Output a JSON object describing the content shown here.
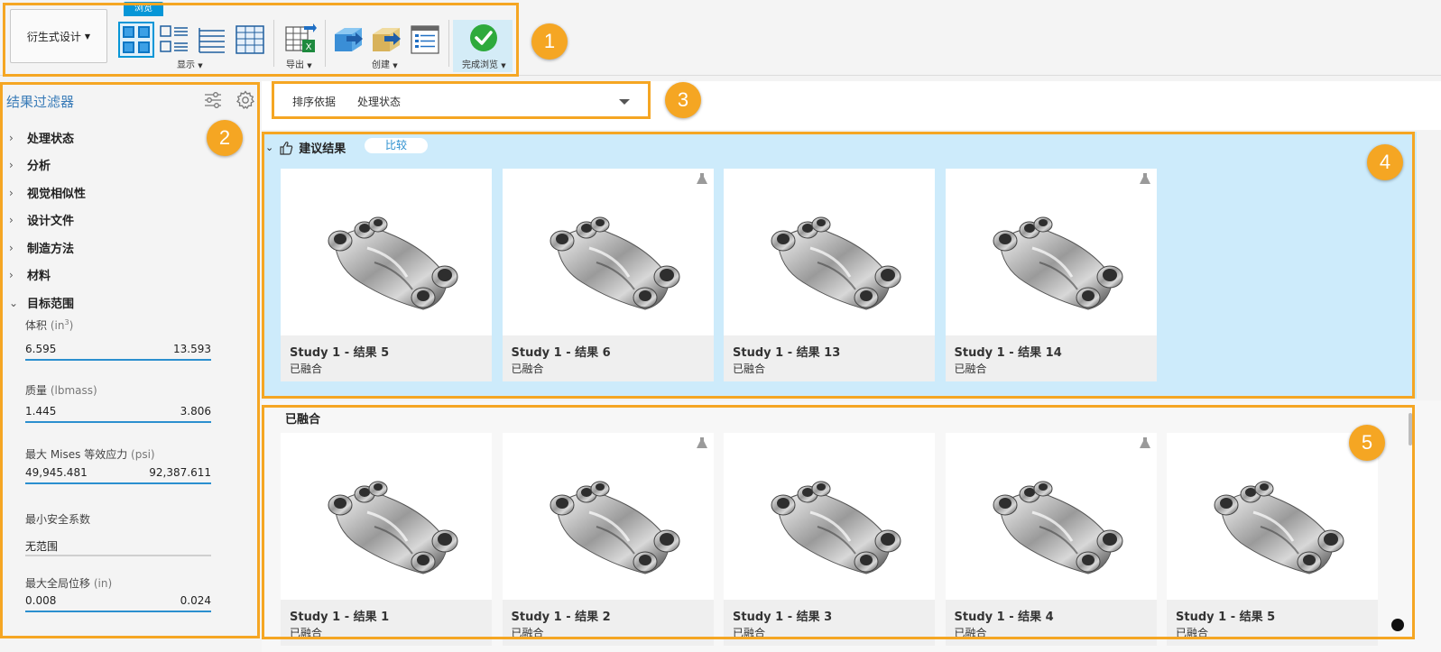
{
  "ribbon": {
    "workspace_label": "衍生式设计",
    "active_tab": "浏览",
    "panels": {
      "display": "显示",
      "export": "导出",
      "create": "创建",
      "finish": "完成浏览"
    }
  },
  "sidebar": {
    "title": "结果过滤器",
    "filters": [
      {
        "label": "处理状态",
        "expanded": false
      },
      {
        "label": "分析",
        "expanded": false
      },
      {
        "label": "视觉相似性",
        "expanded": false
      },
      {
        "label": "设计文件",
        "expanded": false
      },
      {
        "label": "制造方法",
        "expanded": false
      },
      {
        "label": "材料",
        "expanded": false
      },
      {
        "label": "目标范围",
        "expanded": true
      }
    ],
    "ranges": [
      {
        "label": "体积",
        "unit_pre": "(in",
        "unit_sup": "3",
        "unit_post": ")",
        "min": "6.595",
        "max": "13.593"
      },
      {
        "label": "质量",
        "unit": "(lbmass)",
        "min": "1.445",
        "max": "3.806"
      },
      {
        "label": "最大 Mises 等效应力",
        "unit": "(psi)",
        "min": "49,945.481",
        "max": "92,387.611"
      },
      {
        "label": "最小安全系数",
        "unit": "",
        "value": "无范围"
      },
      {
        "label": "最大全局位移",
        "unit": "(in)",
        "min": "0.008",
        "max": "0.024"
      }
    ]
  },
  "sort": {
    "label": "排序依据",
    "value": "处理状态"
  },
  "recommended": {
    "title": "建议结果",
    "compare_label": "比较",
    "cards": [
      {
        "name": "Study 1 - 结果 5",
        "status": "已融合",
        "flask": false
      },
      {
        "name": "Study 1 - 结果 6",
        "status": "已融合",
        "flask": true
      },
      {
        "name": "Study 1 - 结果 13",
        "status": "已融合",
        "flask": false
      },
      {
        "name": "Study 1 - 结果 14",
        "status": "已融合",
        "flask": true
      }
    ]
  },
  "fused": {
    "title": "已融合",
    "cards": [
      {
        "name": "Study 1 - 结果 1",
        "status": "已融合",
        "flask": false
      },
      {
        "name": "Study 1 - 结果 2",
        "status": "已融合",
        "flask": true
      },
      {
        "name": "Study 1 - 结果 3",
        "status": "已融合",
        "flask": false
      },
      {
        "name": "Study 1 - 结果 4",
        "status": "已融合",
        "flask": true
      },
      {
        "name": "Study 1 - 结果 5",
        "status": "已融合",
        "flask": false
      }
    ]
  },
  "annotations": [
    "1",
    "2",
    "3",
    "4",
    "5"
  ],
  "colors": {
    "accent": "#0696d7",
    "annotation": "#f5a623",
    "recommended_bg": "#cdebfb",
    "range_line": "#2b8fcf"
  }
}
